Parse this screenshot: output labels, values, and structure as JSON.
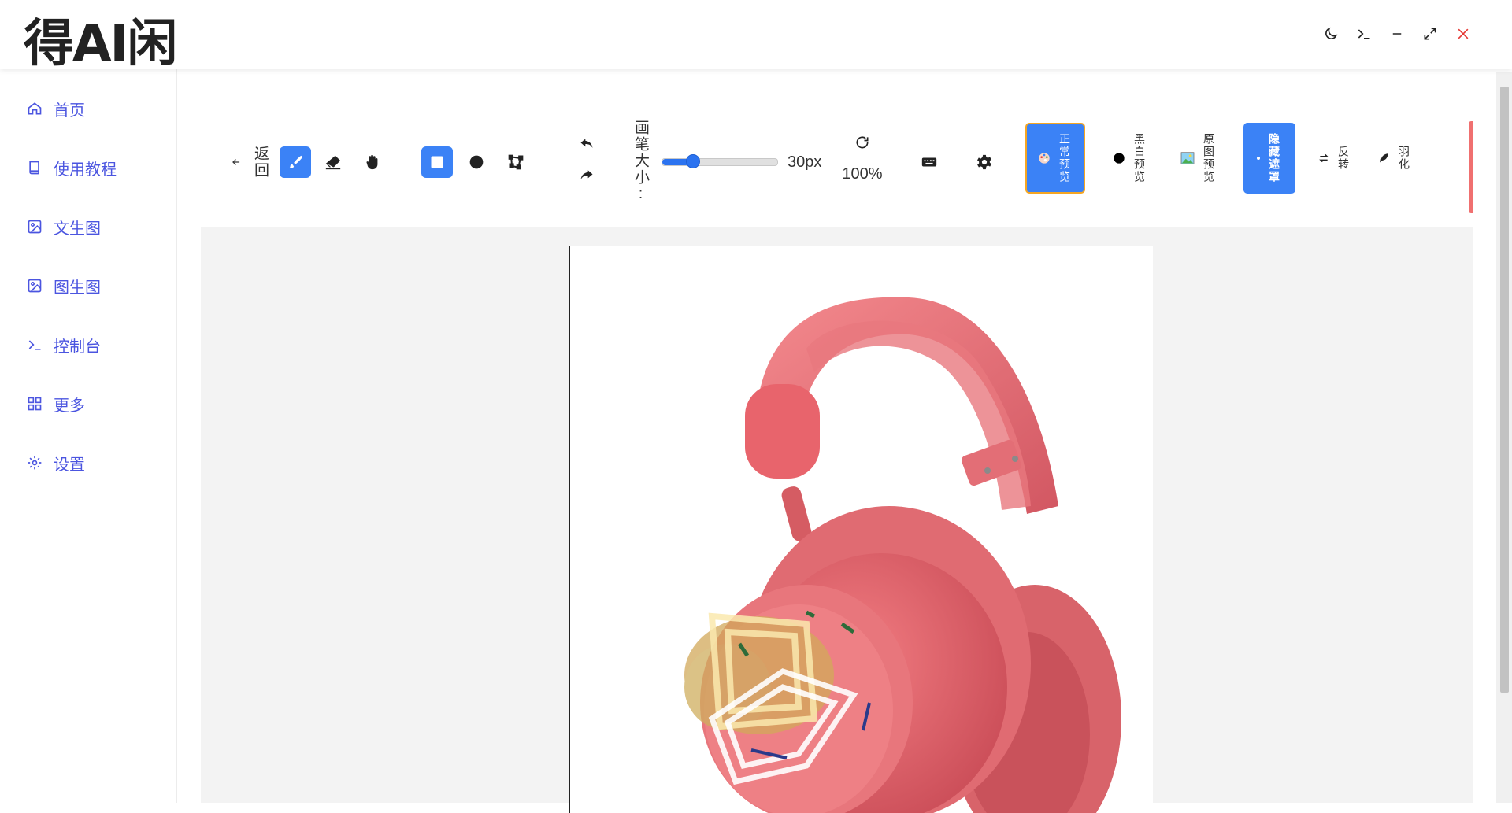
{
  "app": {
    "logo": "得AI闲"
  },
  "window_controls": [
    "moon-icon",
    "terminal-icon",
    "minimize-icon",
    "maximize-icon",
    "close-icon"
  ],
  "sidebar": {
    "items": [
      {
        "label": "首页",
        "icon": "home-icon"
      },
      {
        "label": "使用教程",
        "icon": "book-icon"
      },
      {
        "label": "文生图",
        "icon": "image-icon"
      },
      {
        "label": "图生图",
        "icon": "image-icon"
      },
      {
        "label": "控制台",
        "icon": "terminal-icon"
      },
      {
        "label": "更多",
        "icon": "grid-icon"
      },
      {
        "label": "设置",
        "icon": "gear-icon"
      }
    ]
  },
  "toolbar": {
    "back_label": "返回",
    "brush_size_label": "画笔大小:",
    "brush_size_value": "30px",
    "brush_size": 30,
    "brush_size_fraction": 0.27,
    "zoom_label": "100%",
    "normal_preview_label": "正常预览",
    "bw_preview_label": "黑白预览",
    "original_preview_label": "原图预览",
    "hide_mask_label": "隐藏遮罩",
    "invert_label": "反转",
    "feather_label": "羽化"
  },
  "colors": {
    "accent": "#3b82f6",
    "nav_text": "#4b55e0",
    "active_border": "#f5a623",
    "close": "#e53935"
  }
}
